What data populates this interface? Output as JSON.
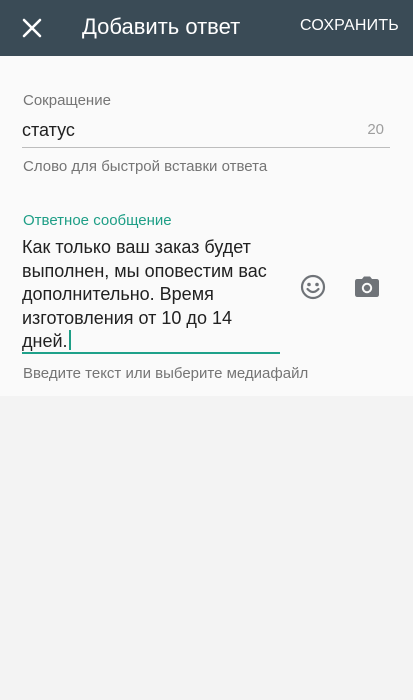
{
  "header": {
    "title": "Добавить ответ",
    "save_label": "СОХРАНИТЬ",
    "close_icon": "close-icon",
    "background_color": "#3a4b56"
  },
  "shortcut": {
    "label": "Сокращение",
    "value": "статус",
    "counter": "20",
    "helper": "Слово для быстрой вставки ответа"
  },
  "reply": {
    "label": "Ответное сообщение",
    "lines": [
      "Как только ваш заказ будет",
      "выполнен, мы оповестим вас",
      "дополнительно. Время",
      "изготовления от 10 до 14",
      "дней."
    ],
    "helper": "Введите текст или выберите медиафайл",
    "accent_color": "#1e9e86",
    "emoji_icon": "emoji-icon",
    "camera_icon": "camera-icon"
  }
}
